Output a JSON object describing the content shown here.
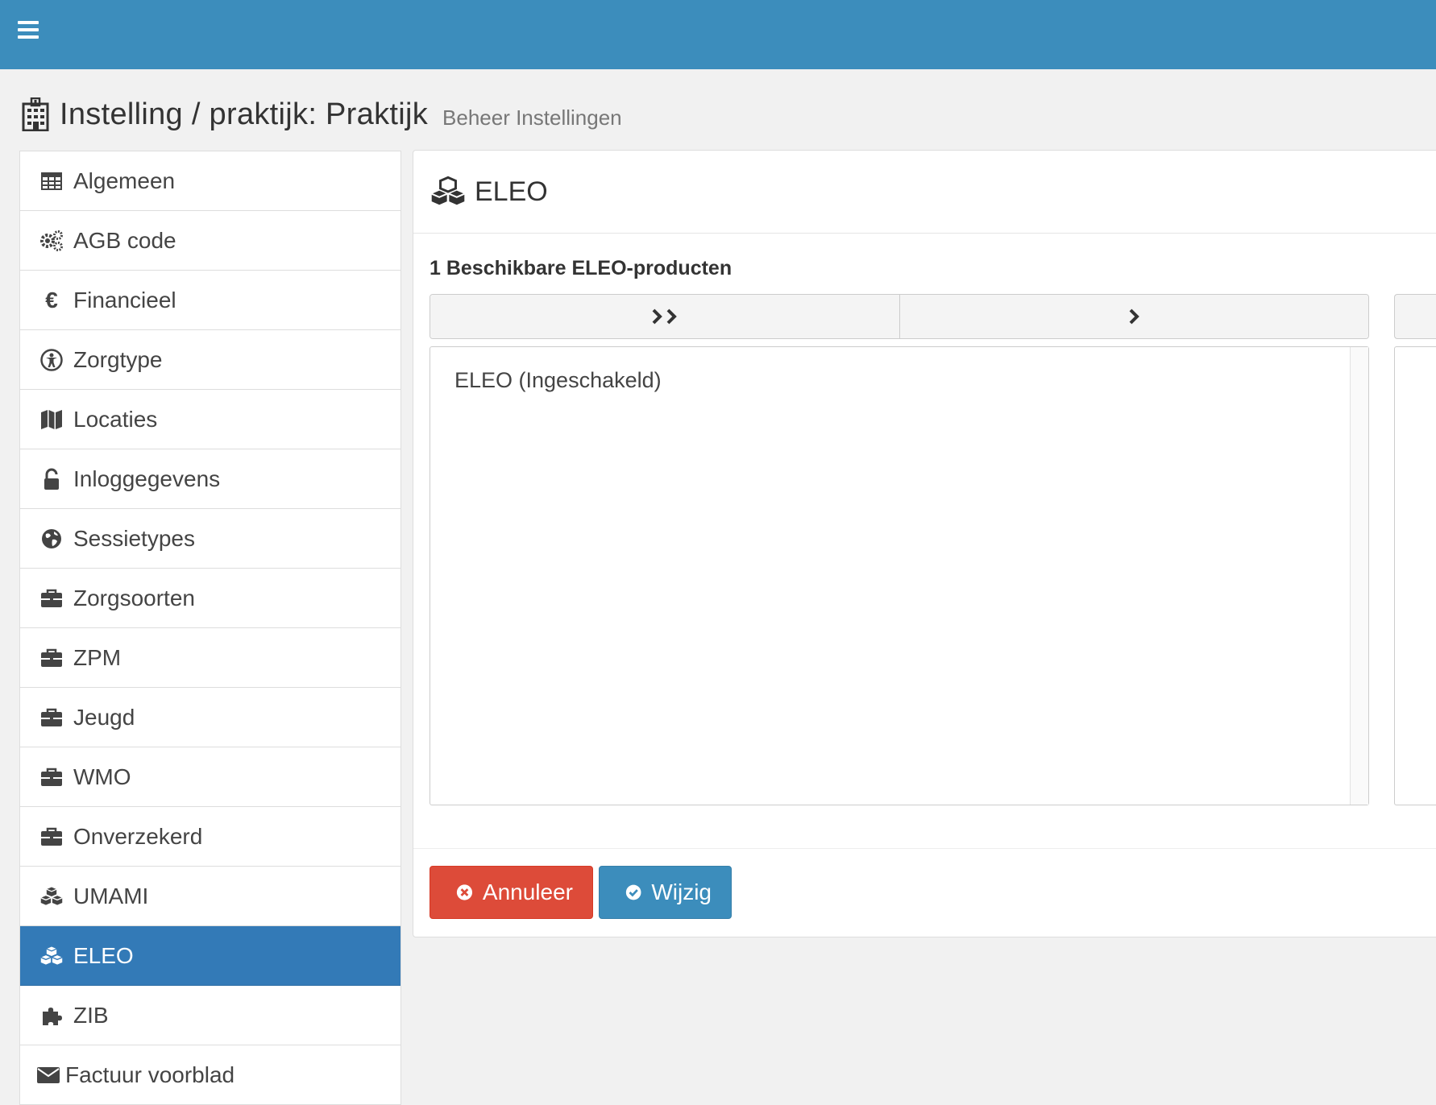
{
  "header": {
    "title": "Instelling / praktijk: Praktijk",
    "subtitle": "Beheer Instellingen"
  },
  "sidebar": {
    "items": [
      {
        "label": "Algemeen",
        "icon": "table-icon"
      },
      {
        "label": "AGB code",
        "icon": "gears-icon"
      },
      {
        "label": "Financieel",
        "icon": "euro-icon"
      },
      {
        "label": "Zorgtype",
        "icon": "accessibility-icon"
      },
      {
        "label": "Locaties",
        "icon": "map-icon"
      },
      {
        "label": "Inloggegevens",
        "icon": "unlock-icon"
      },
      {
        "label": "Sessietypes",
        "icon": "globe-icon"
      },
      {
        "label": "Zorgsoorten",
        "icon": "briefcase-icon"
      },
      {
        "label": "ZPM",
        "icon": "briefcase-icon"
      },
      {
        "label": "Jeugd",
        "icon": "briefcase-icon"
      },
      {
        "label": "WMO",
        "icon": "briefcase-icon"
      },
      {
        "label": "Onverzekerd",
        "icon": "briefcase-icon"
      },
      {
        "label": "UMAMI",
        "icon": "cubes-icon"
      },
      {
        "label": "ELEO",
        "icon": "cubes-icon",
        "active": true
      },
      {
        "label": "ZIB",
        "icon": "puzzle-icon"
      },
      {
        "label": "Factuur voorblad",
        "icon": "envelope-icon"
      }
    ]
  },
  "panel": {
    "title": "ELEO",
    "icon": "cubes-icon",
    "available_label": "1 Beschikbare ELEO-producten",
    "move_all_icon": "double-chevron-right-icon",
    "move_selected_icon": "chevron-right-icon",
    "available_options": [
      "ELEO (Ingeschakeld)"
    ]
  },
  "buttons": {
    "cancel_label": "Annuleer",
    "save_label": "Wijzig"
  },
  "colors": {
    "topbar": "#3c8dbc",
    "active_nav": "#337ab7",
    "danger": "#dd4b39",
    "primary": "#3c8dbc"
  }
}
